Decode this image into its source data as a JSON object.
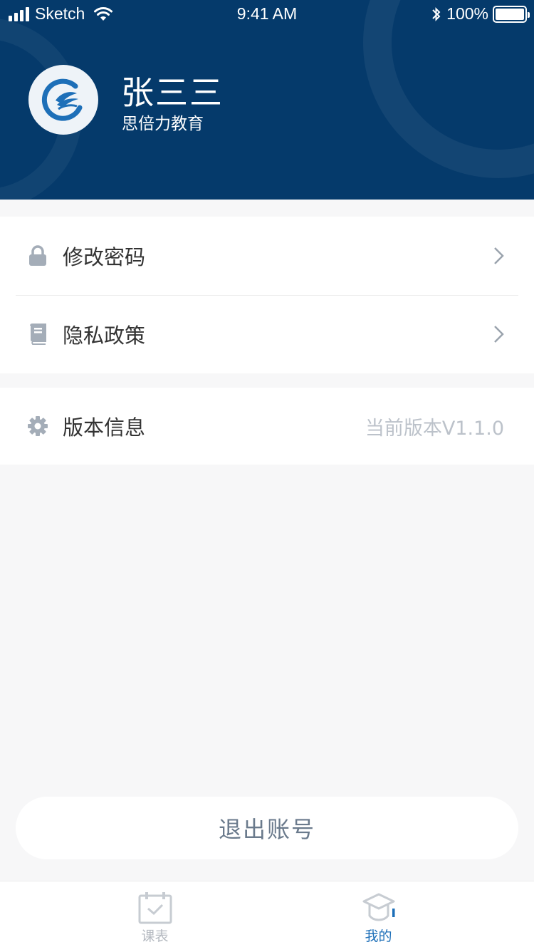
{
  "status_bar": {
    "carrier": "Sketch",
    "time": "9:41 AM",
    "battery": "100%"
  },
  "profile": {
    "name": "张三三",
    "organization": "思倍力教育"
  },
  "menu": {
    "change_password": "修改密码",
    "privacy_policy": "隐私政策",
    "version_info": "版本信息",
    "version_value": "当前版本V1.1.0"
  },
  "logout_label": "退出账号",
  "tabs": [
    {
      "label": "课表",
      "active": false
    },
    {
      "label": "我的",
      "active": true
    }
  ],
  "colors": {
    "header_bg": "#053a6b",
    "accent": "#1d6fb8",
    "inactive_tab": "#b4b9c0",
    "icon_gray": "#a4adb8"
  },
  "icons": {
    "status_signal": "signal-bars-icon",
    "status_wifi": "wifi-icon",
    "status_bluetooth": "bluetooth-icon",
    "status_battery": "battery-icon",
    "logo": "brand-logo",
    "change_password": "lock-icon",
    "privacy_policy": "book-icon",
    "version_info": "gear-icon",
    "row_chevron": "chevron-right-icon",
    "tab_schedule": "calendar-check-icon",
    "tab_mine": "graduation-cap-icon"
  }
}
